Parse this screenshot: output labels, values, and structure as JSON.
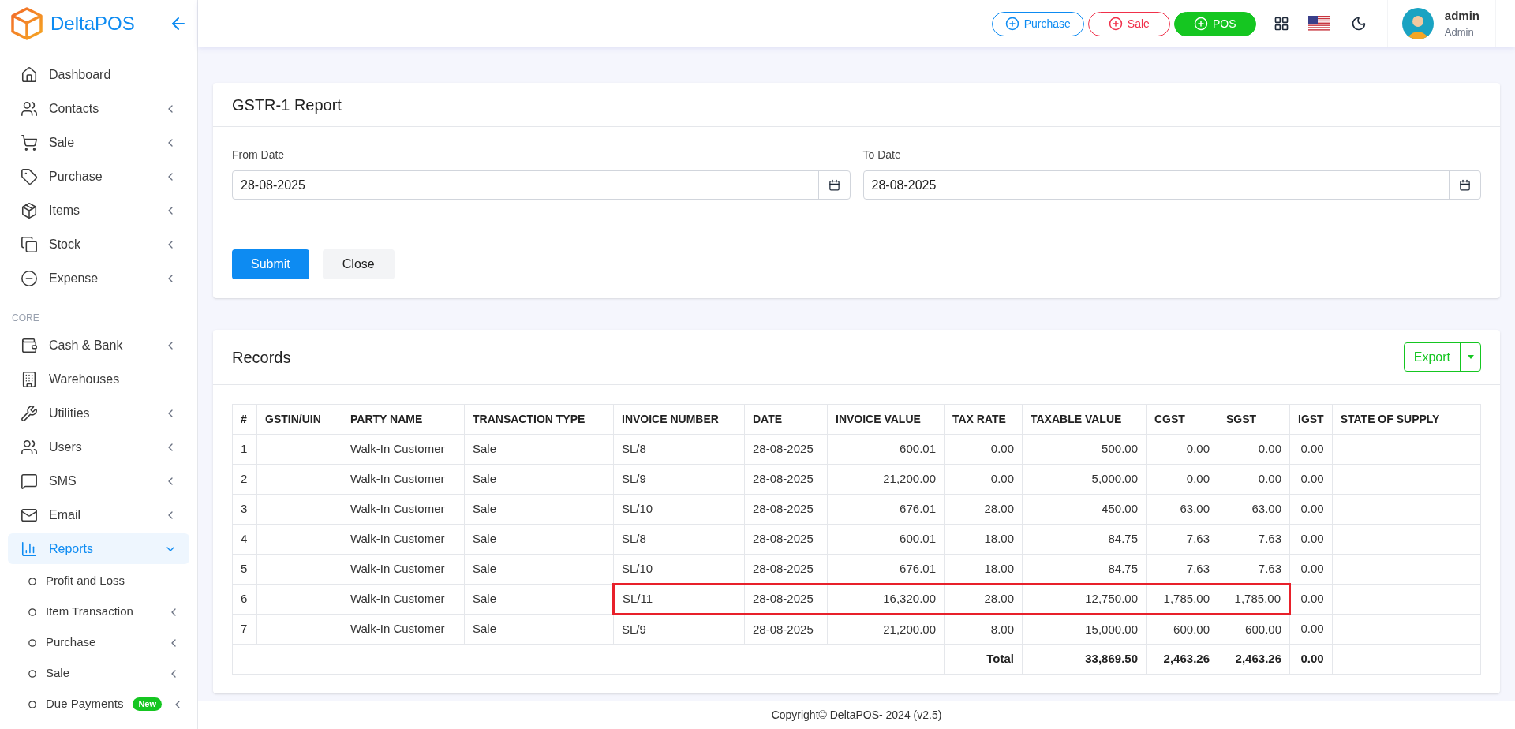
{
  "brand": {
    "name": "DeltaPOS"
  },
  "sidebar": {
    "items": [
      {
        "kind": "item",
        "label": "Dashboard",
        "selected": false
      },
      {
        "kind": "item",
        "label": "Contacts",
        "selected": false,
        "expanded": false
      },
      {
        "kind": "item",
        "label": "Sale",
        "selected": false,
        "expanded": false
      },
      {
        "kind": "item",
        "label": "Purchase",
        "selected": false,
        "expanded": false
      },
      {
        "kind": "item",
        "label": "Items",
        "selected": false,
        "expanded": false
      },
      {
        "kind": "item",
        "label": "Stock",
        "selected": false,
        "expanded": false
      },
      {
        "kind": "item",
        "label": "Expense",
        "selected": false,
        "expanded": false
      },
      {
        "kind": "section",
        "label": "CORE"
      },
      {
        "kind": "item",
        "label": "Cash & Bank",
        "selected": false,
        "expanded": false
      },
      {
        "kind": "item",
        "label": "Warehouses",
        "selected": false
      },
      {
        "kind": "item",
        "label": "Utilities",
        "selected": false,
        "expanded": false
      },
      {
        "kind": "item",
        "label": "Users",
        "selected": false,
        "expanded": false
      },
      {
        "kind": "item",
        "label": "SMS",
        "selected": false,
        "expanded": false
      },
      {
        "kind": "item",
        "label": "Email",
        "selected": false,
        "expanded": false
      },
      {
        "kind": "item",
        "label": "Reports",
        "selected": true,
        "expanded": true,
        "children": [
          {
            "label": "Profit and Loss",
            "selected": false
          },
          {
            "label": "Item Transaction",
            "selected": false,
            "expanded": false
          },
          {
            "label": "Purchase",
            "selected": false,
            "expanded": false
          },
          {
            "label": "Sale",
            "selected": false,
            "expanded": false
          },
          {
            "label": "Due Payments",
            "selected": false,
            "expanded": false,
            "badge": "New"
          }
        ]
      }
    ]
  },
  "topbar": {
    "buttons": [
      {
        "label": "Purchase",
        "kind": "outline",
        "color": "#0d8bf2"
      },
      {
        "label": "Sale",
        "kind": "outline",
        "color": "#f0304a"
      },
      {
        "label": "POS",
        "kind": "filled",
        "color": "#15c621"
      }
    ],
    "user": {
      "name": "admin",
      "role": "Admin"
    }
  },
  "report_card": {
    "title": "GSTR-1 Report",
    "from_date": {
      "label": "From Date",
      "value": "28-08-2025"
    },
    "to_date": {
      "label": "To Date",
      "value": "28-08-2025"
    },
    "submit": "Submit",
    "close": "Close"
  },
  "records": {
    "title": "Records",
    "export": "Export",
    "table": {
      "columns": [
        "#",
        "GSTIN/UIN",
        "PARTY NAME",
        "TRANSACTION TYPE",
        "INVOICE NUMBER",
        "DATE",
        "INVOICE VALUE",
        "TAX RATE",
        "TAXABLE VALUE",
        "CGST",
        "SGST",
        "IGST",
        "STATE OF SUPPLY"
      ],
      "rows": [
        {
          "cells": [
            "1",
            "",
            "Walk-In Customer",
            "Sale",
            "SL/8",
            "28-08-2025",
            "600.01",
            "0.00",
            "500.00",
            "0.00",
            "0.00",
            "0.00",
            ""
          ],
          "highlighted": false
        },
        {
          "cells": [
            "2",
            "",
            "Walk-In Customer",
            "Sale",
            "SL/9",
            "28-08-2025",
            "21,200.00",
            "0.00",
            "5,000.00",
            "0.00",
            "0.00",
            "0.00",
            ""
          ],
          "highlighted": false
        },
        {
          "cells": [
            "3",
            "",
            "Walk-In Customer",
            "Sale",
            "SL/10",
            "28-08-2025",
            "676.01",
            "28.00",
            "450.00",
            "63.00",
            "63.00",
            "0.00",
            ""
          ],
          "highlighted": false
        },
        {
          "cells": [
            "4",
            "",
            "Walk-In Customer",
            "Sale",
            "SL/8",
            "28-08-2025",
            "600.01",
            "18.00",
            "84.75",
            "7.63",
            "7.63",
            "0.00",
            ""
          ],
          "highlighted": false
        },
        {
          "cells": [
            "5",
            "",
            "Walk-In Customer",
            "Sale",
            "SL/10",
            "28-08-2025",
            "676.01",
            "18.00",
            "84.75",
            "7.63",
            "7.63",
            "0.00",
            ""
          ],
          "highlighted": false
        },
        {
          "cells": [
            "6",
            "",
            "Walk-In Customer",
            "Sale",
            "SL/11",
            "28-08-2025",
            "16,320.00",
            "28.00",
            "12,750.00",
            "1,785.00",
            "1,785.00",
            "0.00",
            ""
          ],
          "highlighted": true
        },
        {
          "cells": [
            "7",
            "",
            "Walk-In Customer",
            "Sale",
            "SL/9",
            "28-08-2025",
            "21,200.00",
            "8.00",
            "15,000.00",
            "600.00",
            "600.00",
            "0.00",
            ""
          ],
          "highlighted": false
        }
      ],
      "total": {
        "label": "Total",
        "taxable_value": "33,869.50",
        "cgst": "2,463.26",
        "sgst": "2,463.26",
        "igst": "0.00"
      }
    }
  },
  "footer": "Copyright© DeltaPOS- 2024 (v2.5)"
}
